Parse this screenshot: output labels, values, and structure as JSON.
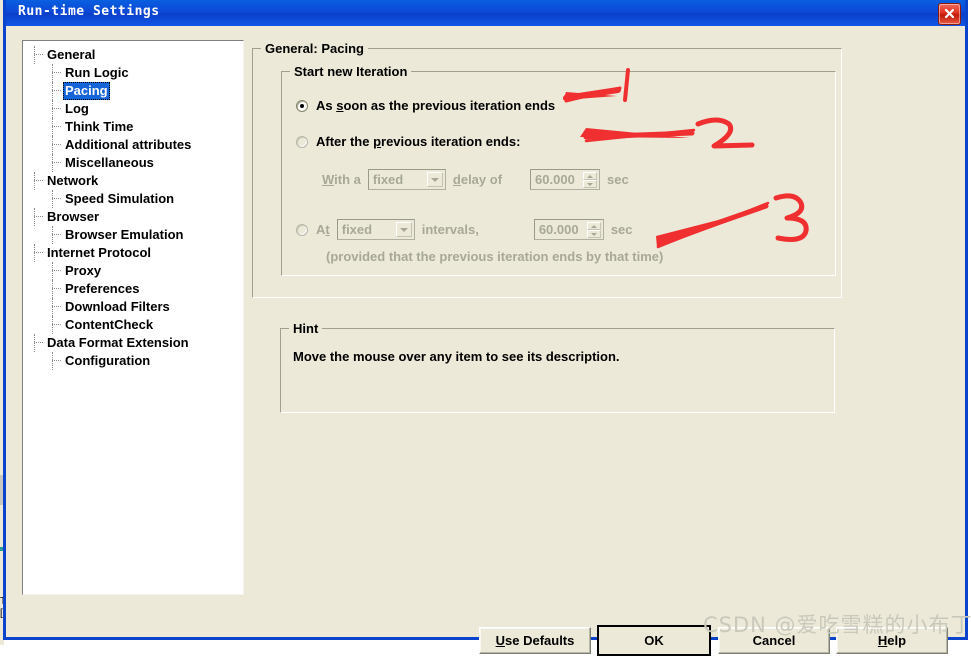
{
  "window": {
    "title": "Run-time Settings",
    "close_icon": "close-icon"
  },
  "tree": {
    "items": [
      {
        "label": "General",
        "level": 0,
        "selected": false
      },
      {
        "label": "Run Logic",
        "level": 1,
        "selected": false
      },
      {
        "label": "Pacing",
        "level": 1,
        "selected": true
      },
      {
        "label": "Log",
        "level": 1,
        "selected": false
      },
      {
        "label": "Think Time",
        "level": 1,
        "selected": false
      },
      {
        "label": "Additional attributes",
        "level": 1,
        "selected": false
      },
      {
        "label": "Miscellaneous",
        "level": 1,
        "selected": false
      },
      {
        "label": "Network",
        "level": 0,
        "selected": false
      },
      {
        "label": "Speed Simulation",
        "level": 1,
        "selected": false
      },
      {
        "label": "Browser",
        "level": 0,
        "selected": false
      },
      {
        "label": "Browser Emulation",
        "level": 1,
        "selected": false
      },
      {
        "label": "Internet Protocol",
        "level": 0,
        "selected": false
      },
      {
        "label": "Proxy",
        "level": 1,
        "selected": false
      },
      {
        "label": "Preferences",
        "level": 1,
        "selected": false
      },
      {
        "label": "Download Filters",
        "level": 1,
        "selected": false
      },
      {
        "label": "ContentCheck",
        "level": 1,
        "selected": false
      },
      {
        "label": "Data Format Extension",
        "level": 0,
        "selected": false
      },
      {
        "label": "Configuration",
        "level": 1,
        "selected": false
      }
    ]
  },
  "pacing": {
    "group_label": "General: Pacing",
    "iteration_group_label": "Start new Iteration",
    "option_asap": {
      "label": "As soon as the previous iteration ends",
      "underline": "s",
      "checked": true
    },
    "option_after": {
      "label": "After the previous iteration ends:",
      "underline": "p",
      "checked": false
    },
    "delay_row": {
      "with_a_label": "With a",
      "with_a_underline": "W",
      "mode_value": "fixed",
      "delay_of_label": "delay of",
      "delay_of_underline": "d",
      "delay_value": "60.000",
      "unit": "sec"
    },
    "option_at": {
      "label": "At",
      "underline": "t",
      "checked": false
    },
    "at_row": {
      "mode_value": "fixed",
      "intervals_label": "intervals,",
      "interval_value": "60.000",
      "unit": "sec"
    },
    "note": "(provided that the previous iteration ends by that time)"
  },
  "hint": {
    "group_label": "Hint",
    "text": "Move the mouse over any item to see its description."
  },
  "buttons": {
    "use_defaults": "Use Defaults",
    "use_defaults_underline": "U",
    "ok": "OK",
    "cancel": "Cancel",
    "help": "Help",
    "help_underline": "H"
  },
  "annotations": {
    "color": "#f03030",
    "marks": [
      {
        "name": "annotation-1",
        "text": "1"
      },
      {
        "name": "annotation-2",
        "text": "2"
      },
      {
        "name": "annotation-3",
        "text": "3"
      }
    ]
  },
  "watermark": {
    "text": "CSDN @爱吃雪糕的小布丁"
  },
  "colors": {
    "dialog_bg": "#ece9d8",
    "titlebar_blue": "#0b47d6",
    "selection_blue": "#1664d8",
    "disabled_text": "#a8a896",
    "annotation_red": "#f03030"
  }
}
